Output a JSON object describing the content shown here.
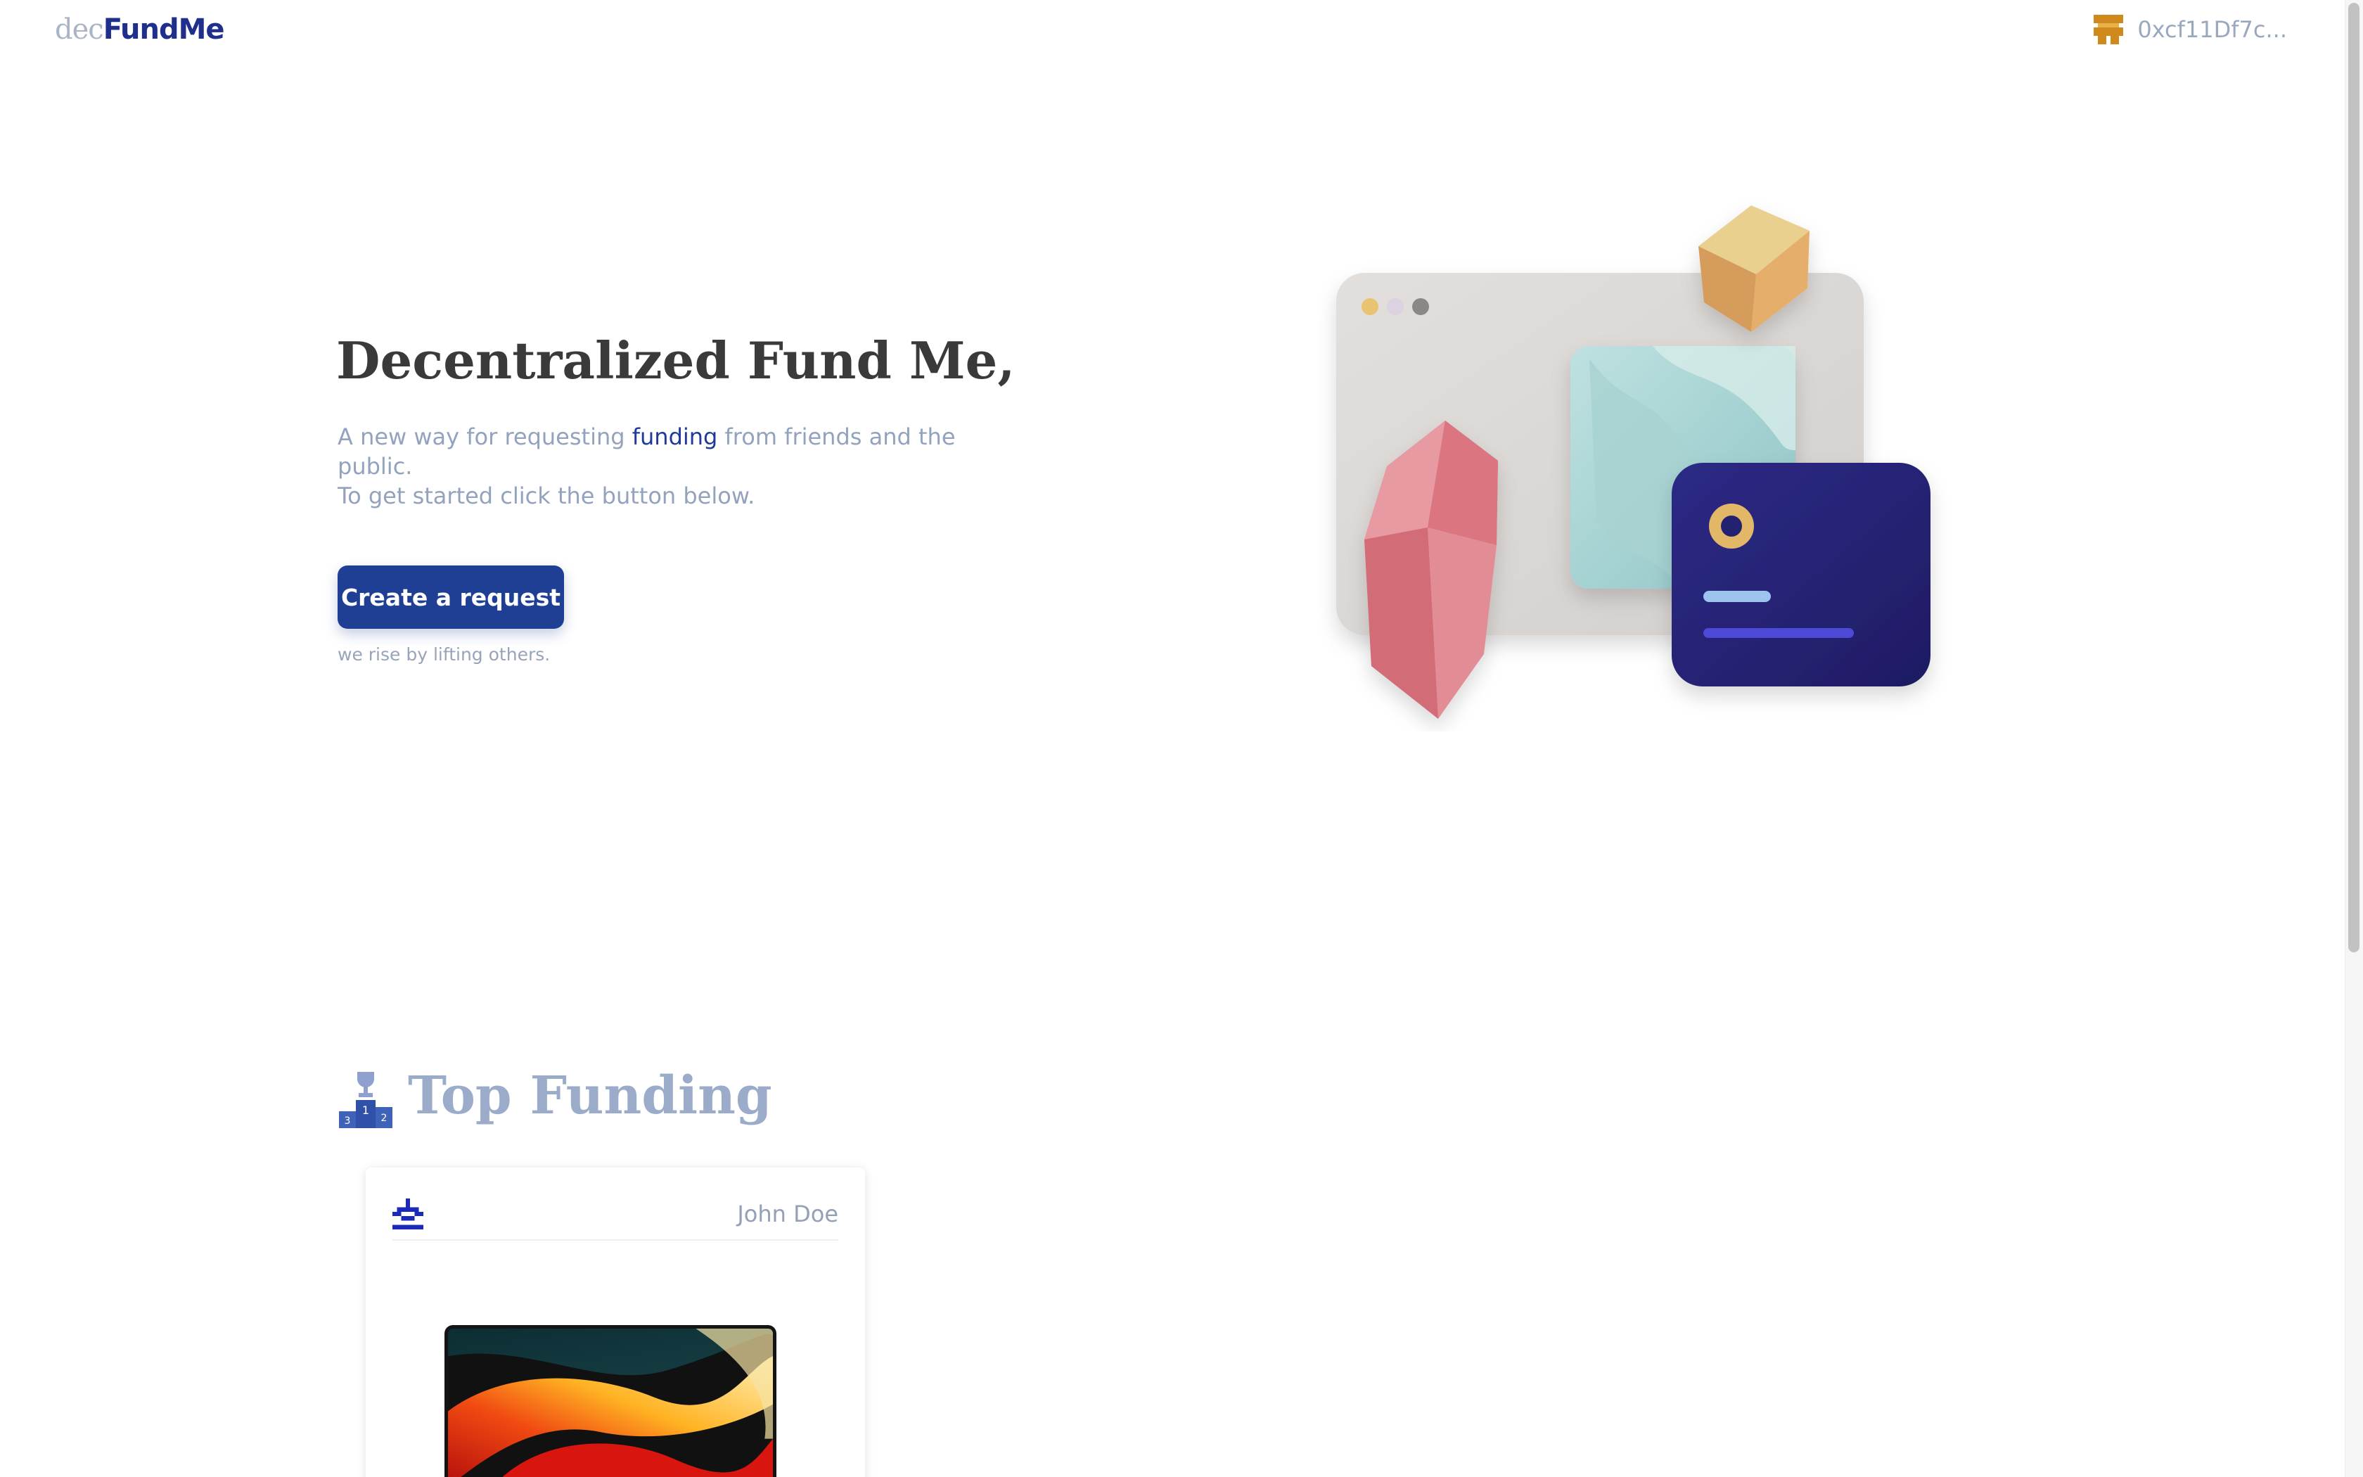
{
  "header": {
    "logo_prefix": "dec",
    "logo_main": "FundMe",
    "wallet_icon": "pixel-avatar-icon",
    "wallet_address": "0xcf11Df7c..."
  },
  "hero": {
    "title": "Decentralized Fund Me,",
    "subtitle_before": "A new way for requesting ",
    "subtitle_accent": "funding",
    "subtitle_after": " from friends and the public.",
    "subtitle_line2": "To get started click the button below.",
    "cta_label": "Create a request",
    "tagline": "we rise by lifting others."
  },
  "top_funding": {
    "icon": "podium-trophy-icon",
    "title": "Top Funding",
    "cards": [
      {
        "avatar_icon": "pixel-avatar-icon",
        "author": "John Doe",
        "image": "laptop-image"
      }
    ]
  },
  "colors": {
    "brand_navy": "#1f2f8c",
    "button": "#1f3f95",
    "accent_teal": "#33c9a5",
    "muted_text": "#93a3bd",
    "wallet_icon": "#d08a1c"
  }
}
